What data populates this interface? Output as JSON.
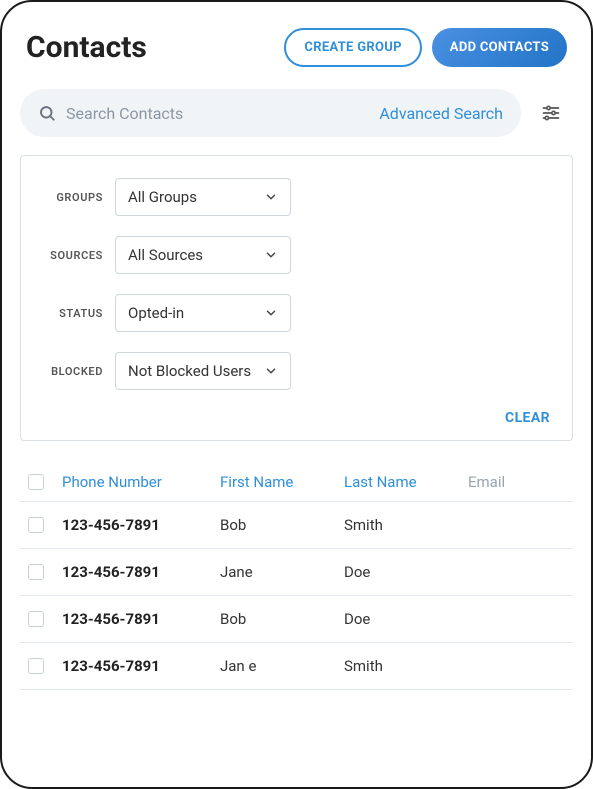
{
  "header": {
    "title": "Contacts",
    "create_group": "CREATE GROUP",
    "add_contacts": "ADD CONTACTS"
  },
  "search": {
    "placeholder": "Search Contacts",
    "advanced": "Advanced Search"
  },
  "filters": {
    "groups_label": "GROUPS",
    "groups_value": "All Groups",
    "sources_label": "SOURCES",
    "sources_value": "All Sources",
    "status_label": "STATUS",
    "status_value": "Opted-in",
    "blocked_label": "BLOCKED",
    "blocked_value": "Not Blocked Users",
    "clear": "CLEAR"
  },
  "table": {
    "headers": {
      "phone": "Phone Number",
      "first": "First Name",
      "last": "Last Name",
      "email": "Email"
    },
    "rows": [
      {
        "phone": "123-456-7891",
        "first": "Bob",
        "last": "Smith"
      },
      {
        "phone": "123-456-7891",
        "first": "Jane",
        "last": "Doe"
      },
      {
        "phone": "123-456-7891",
        "first": "Bob",
        "last": "Doe"
      },
      {
        "phone": "123-456-7891",
        "first": "Jan e",
        "last": "Smith"
      }
    ]
  }
}
